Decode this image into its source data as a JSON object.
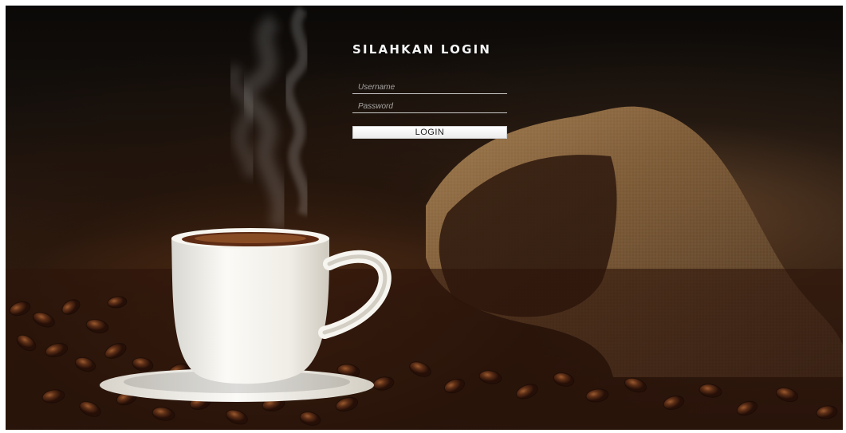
{
  "login": {
    "title": "SILAHKAN LOGIN",
    "username_placeholder": "Username",
    "password_placeholder": "Password",
    "button_label": "LOGIN"
  },
  "theme": {
    "accent": "#ffffff",
    "background": "#2a1a10"
  }
}
